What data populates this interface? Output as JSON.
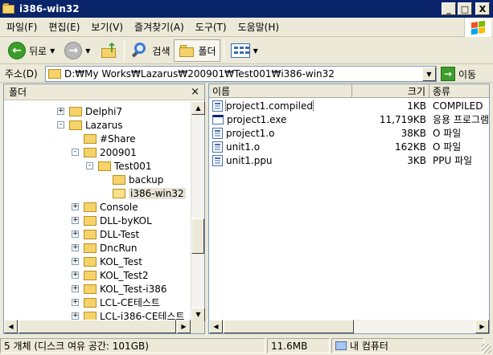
{
  "window": {
    "title": "i386-win32",
    "minimize": "_",
    "maximize": "□",
    "close": "X"
  },
  "menu": [
    "파일(F)",
    "편집(E)",
    "보기(V)",
    "즐겨찾기(A)",
    "도구(T)",
    "도움말(H)"
  ],
  "toolbar": {
    "back_label": "뒤로",
    "search_label": "검색",
    "folders_label": "폴더"
  },
  "address": {
    "label": "주소(D)",
    "path": "D:₩My Works₩Lazarus₩200901₩Test001₩i386-win32",
    "go_label": "이동"
  },
  "folder_pane": {
    "title": "폴더",
    "close": "×",
    "tree": [
      {
        "label": "Delphi7",
        "level": 0,
        "expander": "+",
        "selected": false
      },
      {
        "label": "Lazarus",
        "level": 0,
        "expander": "-",
        "selected": false
      },
      {
        "label": "#Share",
        "level": 1,
        "expander": "",
        "selected": false
      },
      {
        "label": "200901",
        "level": 1,
        "expander": "-",
        "selected": false
      },
      {
        "label": "Test001",
        "level": 2,
        "expander": "-",
        "selected": false
      },
      {
        "label": "backup",
        "level": 3,
        "expander": "",
        "selected": false
      },
      {
        "label": "i386-win32",
        "level": 3,
        "expander": "",
        "selected": true
      },
      {
        "label": "Console",
        "level": 1,
        "expander": "+",
        "selected": false
      },
      {
        "label": "DLL-byKOL",
        "level": 1,
        "expander": "+",
        "selected": false
      },
      {
        "label": "DLL-Test",
        "level": 1,
        "expander": "+",
        "selected": false
      },
      {
        "label": "DncRun",
        "level": 1,
        "expander": "+",
        "selected": false
      },
      {
        "label": "KOL_Test",
        "level": 1,
        "expander": "+",
        "selected": false
      },
      {
        "label": "KOL_Test2",
        "level": 1,
        "expander": "+",
        "selected": false
      },
      {
        "label": "KOL_Test-i386",
        "level": 1,
        "expander": "+",
        "selected": false
      },
      {
        "label": "LCL-CE테스트",
        "level": 1,
        "expander": "+",
        "selected": false
      },
      {
        "label": "LCL-i386-CE테스트",
        "level": 1,
        "expander": "+",
        "selected": false
      }
    ]
  },
  "file_list": {
    "columns": [
      "이름",
      "크기",
      "종류"
    ],
    "files": [
      {
        "name": "project1.compiled",
        "size": "1KB",
        "type": "COMPILED",
        "icon": "file-icon"
      },
      {
        "name": "project1.exe",
        "size": "11,719KB",
        "type": "응용 프로그램",
        "icon": "exe-icon"
      },
      {
        "name": "project1.o",
        "size": "38KB",
        "type": "O 파일",
        "icon": "file-icon"
      },
      {
        "name": "unit1.o",
        "size": "162KB",
        "type": "O 파일",
        "icon": "file-icon"
      },
      {
        "name": "unit1.ppu",
        "size": "3KB",
        "type": "PPU 파일",
        "icon": "file-icon"
      }
    ]
  },
  "status": {
    "objects": "5 개체 (디스크 여유 공간: 101GB)",
    "size": "11.6MB",
    "location": "내 컴퓨터"
  }
}
